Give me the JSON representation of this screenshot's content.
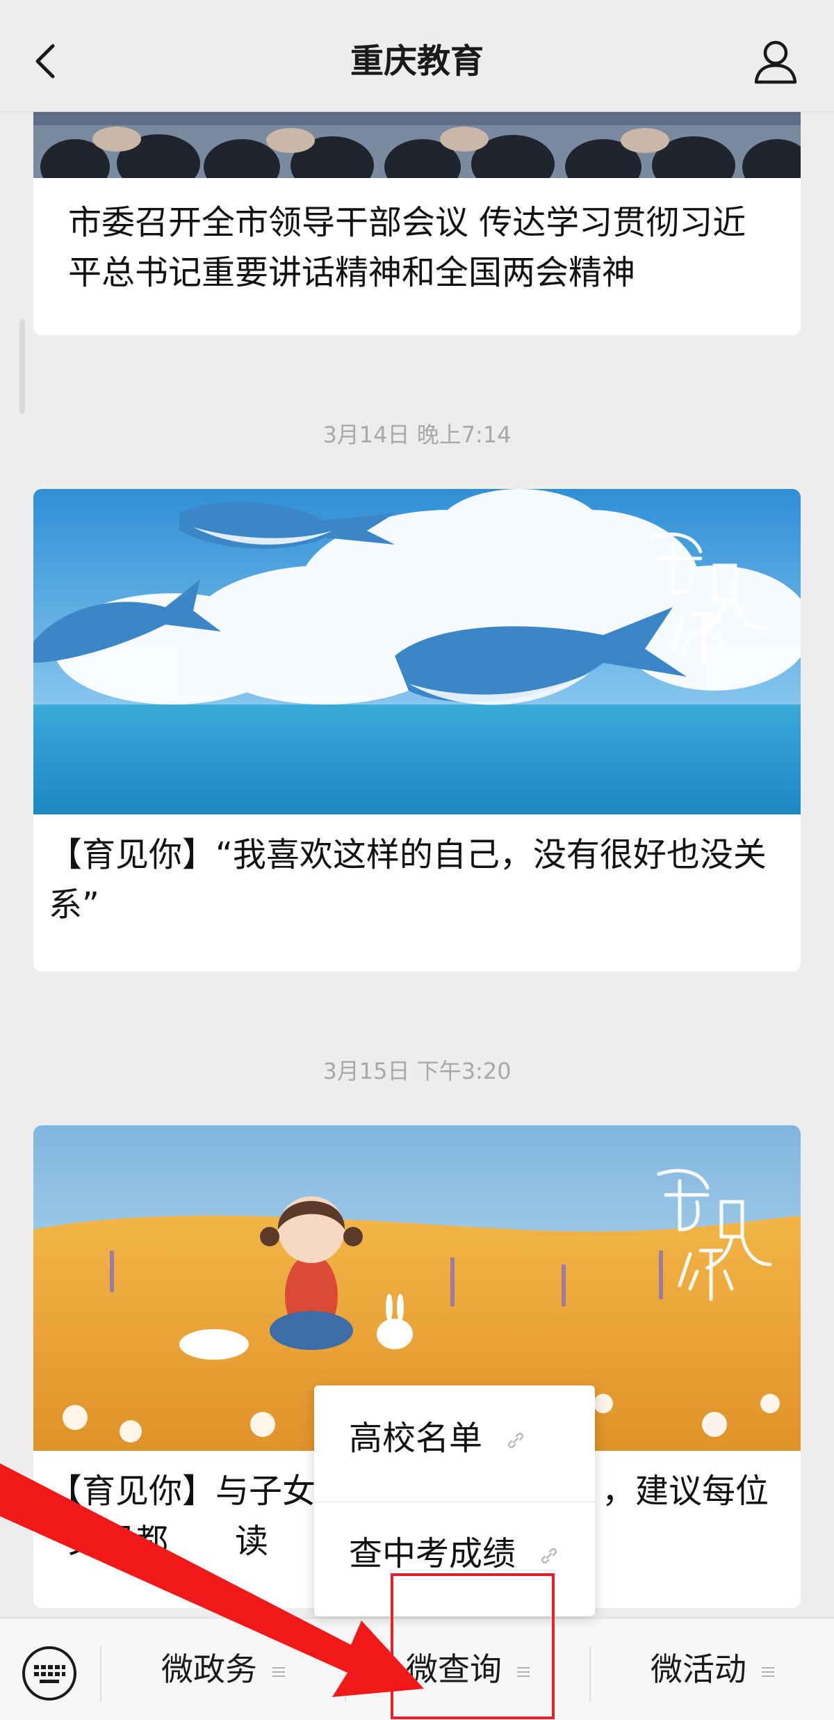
{
  "header": {
    "title": "重庆教育"
  },
  "articles": [
    {
      "title": "市委召开全市领导干部会议 传达学习贯彻习近平总书记重要讲话精神和全国两会精神"
    },
    {
      "timestamp": "3月14日 晚上7:14",
      "title": "【育见你】“我喜欢这样的自己，没有很好也没关系”",
      "image_text": "育见你"
    },
    {
      "timestamp": "3月15日 下午3:20",
      "title_left_line1": "【育见你】与子女",
      "title_right_line1": "，建议每位",
      "title_line2": "父母都",
      "title_line2_end": "读",
      "image_text": "育见你"
    }
  ],
  "popup_menu": {
    "items": [
      {
        "label": "高校名单",
        "icon": "link-icon"
      },
      {
        "label": "查中考成绩",
        "icon": "link-icon"
      }
    ]
  },
  "bottom_menu": {
    "keyboard_icon": "keyboard-icon",
    "tabs": [
      {
        "label": "微政务",
        "icon": "menu-lines-icon"
      },
      {
        "label": "微查询",
        "icon": "menu-lines-icon"
      },
      {
        "label": "微活动",
        "icon": "menu-lines-icon"
      }
    ]
  },
  "annotation": {
    "highlight_color": "#e8202a",
    "arrow_color": "#f01818"
  }
}
